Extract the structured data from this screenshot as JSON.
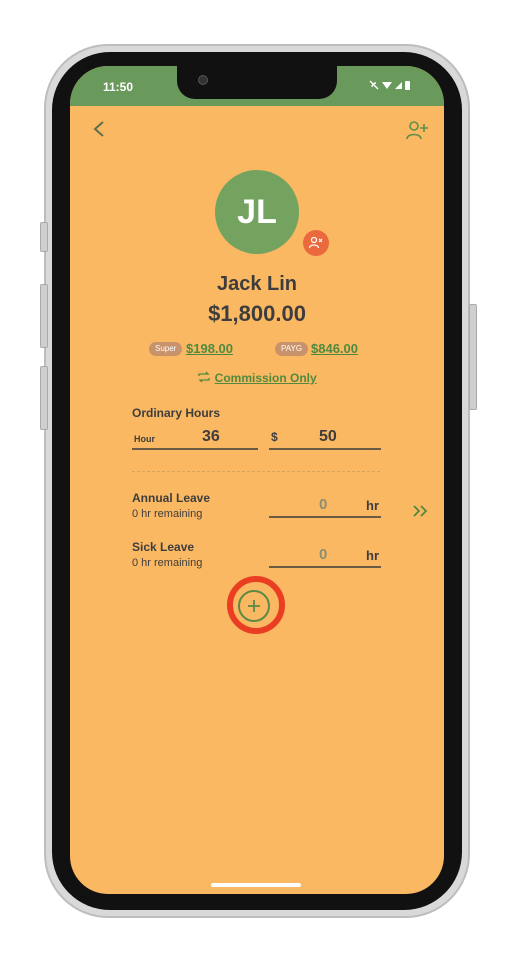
{
  "status": {
    "time": "11:50"
  },
  "employee": {
    "initials": "JL",
    "name": "Jack Lin",
    "amount": "$1,800.00",
    "super_label": "Super",
    "super_value": "$198.00",
    "payg_label": "PAYG",
    "payg_value": "$846.00",
    "pay_type": "Commission Only"
  },
  "ordinary_hours": {
    "title": "Ordinary Hours",
    "hour_label": "Hour",
    "hour_value": "36",
    "rate_label": "$",
    "rate_value": "50"
  },
  "leave": [
    {
      "title": "Annual Leave",
      "remaining": "0 hr remaining",
      "value": "0",
      "unit": "hr"
    },
    {
      "title": "Sick Leave",
      "remaining": "0 hr remaining",
      "value": "0",
      "unit": "hr"
    }
  ],
  "colors": {
    "background": "#fbb862",
    "status_bar": "#6a9a5b",
    "avatar": "#73a35f",
    "accent_green": "#4f8a3e",
    "remove_badge": "#ea6a3e",
    "highlight": "#ea3e23"
  },
  "icons": {
    "back": "chevron-left-icon",
    "add_user": "person-add-icon",
    "remove_user": "person-remove-icon",
    "swap": "swap-icon",
    "expand": "double-chevron-right-icon",
    "add": "plus-circle-icon"
  }
}
